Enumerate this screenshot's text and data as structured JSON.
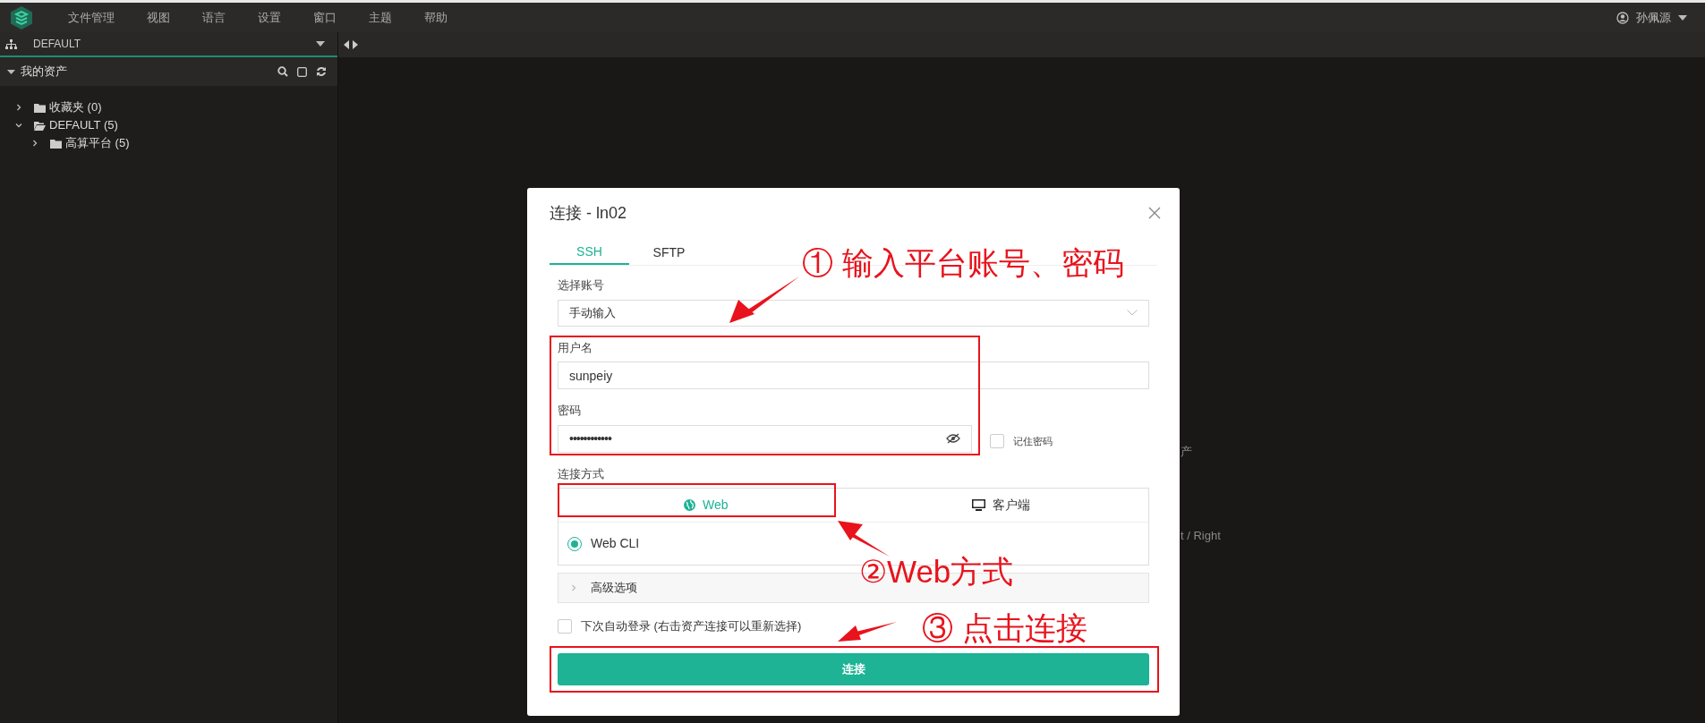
{
  "menu": {
    "items": [
      "文件管理",
      "视图",
      "语言",
      "设置",
      "窗口",
      "主题",
      "帮助"
    ]
  },
  "user": {
    "name": "孙佩源"
  },
  "sidebar": {
    "workspace": "DEFAULT",
    "section": {
      "title": "我的资产",
      "expanded": true
    },
    "tree": [
      {
        "label": "收藏夹 (0)",
        "expanded": false
      },
      {
        "label": "DEFAULT (5)",
        "expanded": true,
        "children": [
          {
            "label": "高算平台 (5)",
            "expanded": false
          }
        ]
      }
    ]
  },
  "background_text": [
    "产",
    "t / Right"
  ],
  "dialog": {
    "title": "连接 - ln02",
    "tabs": [
      {
        "label": "SSH",
        "selected": true
      },
      {
        "label": "SFTP",
        "selected": false
      }
    ],
    "account": {
      "label": "选择账号",
      "value": "手动输入"
    },
    "username": {
      "label": "用户名",
      "value": "sunpeiy"
    },
    "password": {
      "label": "密码",
      "value": "••••••••••••"
    },
    "remember": {
      "label": "记住密码",
      "checked": false
    },
    "method": {
      "label": "连接方式",
      "tabs": [
        {
          "label": "Web",
          "kind": "globe",
          "selected": true
        },
        {
          "label": "客户端",
          "kind": "monitor",
          "selected": false
        }
      ],
      "options": [
        {
          "label": "Web CLI",
          "selected": true
        }
      ]
    },
    "advanced": {
      "label": "高级选项",
      "expanded": false
    },
    "auto_login": {
      "label": "下次自动登录 (右击资产连接可以重新选择)",
      "checked": false
    },
    "connect_button": "连接"
  },
  "annotations": [
    "① 输入平台账号、密码",
    "②Web方式",
    "③ 点击连接"
  ]
}
